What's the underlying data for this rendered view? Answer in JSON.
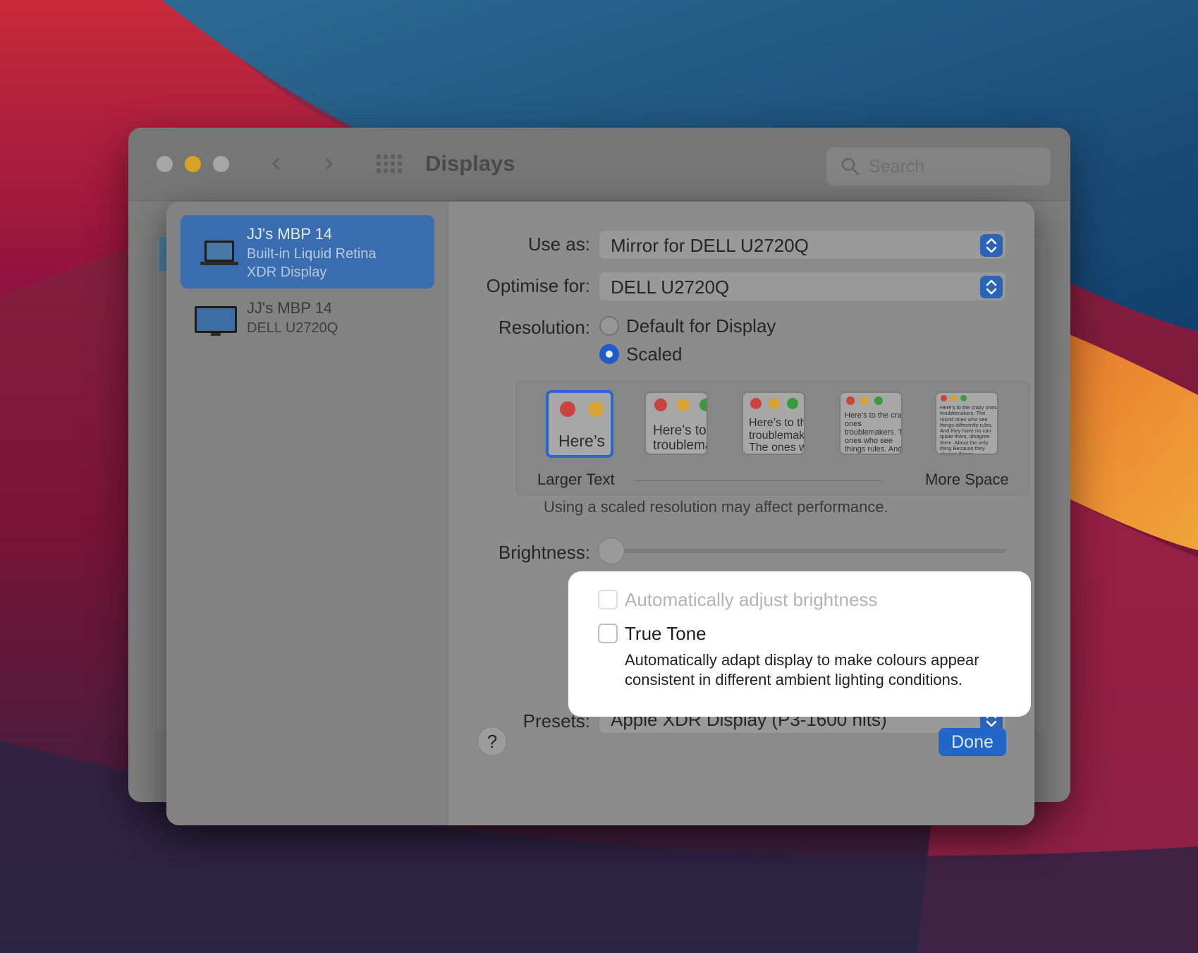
{
  "window": {
    "title": "Displays",
    "search_placeholder": "Search"
  },
  "sidebar": {
    "items": [
      {
        "name": "JJ's MBP 14",
        "sub1": "Built-in Liquid Retina",
        "sub2": "XDR Display",
        "selected": true
      },
      {
        "name": "JJ's MBP 14",
        "sub1": "DELL U2720Q",
        "selected": false
      }
    ]
  },
  "settings": {
    "use_as_label": "Use as:",
    "use_as_value": "Mirror for DELL U2720Q",
    "optimise_label": "Optimise for:",
    "optimise_value": "DELL U2720Q",
    "resolution_label": "Resolution:",
    "resolution_options": [
      "Default for Display",
      "Scaled"
    ],
    "resolution_selected": "Scaled",
    "scale_thumbs": [
      "Here’s",
      "Here’s to the troublemakers",
      "Here’s to the troublemakers. The ones who",
      "Here’s to the crazy ones troublemakers. The ones who see things rules. And they",
      "Here’s to the crazy ones troublemakers. The round ones who see things differently rules. And they have no can quote them, disagree them. About the only thing Because they change things"
    ],
    "scale_left_label": "Larger Text",
    "scale_right_label": "More Space",
    "scale_note": "Using a scaled resolution may affect performance.",
    "brightness_label": "Brightness:",
    "brightness_value": 0,
    "auto_brightness_label": "Automatically adjust brightness",
    "true_tone_label": "True Tone",
    "true_tone_desc": "Automatically adapt display to make colours appear consistent in different ambient lighting conditions.",
    "presets_label": "Presets:",
    "presets_value": "Apple XDR Display (P3-1600 nits)",
    "help_label": "?",
    "done_label": "Done"
  },
  "colors": {
    "accent": "#2266c8",
    "traffic_min": "#d8a324"
  }
}
